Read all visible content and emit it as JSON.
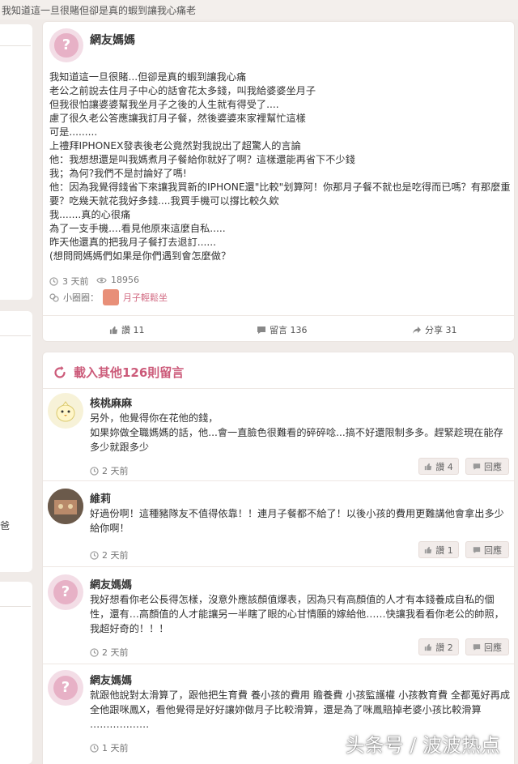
{
  "topbar": {
    "title": "我知道這一旦很賭但卻是真的蝦到讓我心痛老"
  },
  "side": {
    "fragment_char": "爸"
  },
  "post": {
    "author": "網友媽媽",
    "lines": [
      "我知道這一旦很賭...但卻是真的蝦到讓我心痛",
      "老公之前說去住月子中心的話會花太多錢，叫我給婆婆坐月子",
      "但我很怕讓婆婆幫我坐月子之後的人生就有得受了....",
      "慮了很久老公答應讓我訂月子餐，然後婆婆來家裡幫忙這樣",
      "可是.........",
      "上禮拜IPHONEX發表後老公竟然對我說出了超驚人的言論",
      "他：我想想還是叫我媽煮月子餐給你就好了啊？這樣還能再省下不少錢",
      "我；為何?我們不是討論好了嗎!",
      "他：因為我覺得錢省下來讓我買新的IPHONE還\"比較\"划算阿！你那月子餐不就也是吃得而已嗎？有那麼重要？吃幾天就花我好多錢....我買手機可以撐比較久欸",
      "我.......真的心很痛",
      "為了一支手機....看見他原來這麼自私.....",
      "昨天他還真的把我月子餐打去退訂......",
      "(想問問媽媽們如果是你們遇到會怎麼做？"
    ],
    "time": "3 天前",
    "views": "18956",
    "group_label": "小圈圈：",
    "group_name": "月子輕鬆坐",
    "like_label": "讚 11",
    "comment_label": "留言 136",
    "share_label": "分享 31"
  },
  "comments_section": {
    "load_more": "載入其他126則留言",
    "reply_label": "回應",
    "comments": [
      {
        "author": "核桃麻麻",
        "lines": [
          "另外，他覺得你在花他的錢，",
          "如果妳做全職媽媽的話，他...會一直臉色很難看的碎碎唸...搞不好還限制多多。趕緊趁現在能存多少就跟多少"
        ],
        "time": "2 天前",
        "likes": "讚 4"
      },
      {
        "author": "維莉",
        "lines": [
          "好過份啊！這種豬隊友不值得依靠！！連月子餐都不給了！以後小孩的費用更難講他會拿出多少給你啊！"
        ],
        "time": "2 天前",
        "likes": "讚 1"
      },
      {
        "author": "網友媽媽",
        "lines": [
          "我好想看你老公長得怎樣，沒意外應該顏值爆表，因為只有高顏值的人才有本錢養成自私的個性，還有…高顏值的人才能讓另一半瞎了眼的心甘情願的嫁給他……快讓我看看你老公的帥照，我超好奇的！！！"
        ],
        "time": "2 天前",
        "likes": "讚 2"
      },
      {
        "author": "網友媽媽",
        "lines": [
          "就跟他說對太滑算了，跟他把生育費 養小孩的費用 贍養費 小孩監護權 小孩教育費 全都蒐好再成全他跟咪鳳X，看他覺得是好好讓妳做月子比較滑算，還是為了咪鳳賠掉老婆小孩比較滑算",
          "………………"
        ],
        "time": "1 天前",
        "likes": ""
      }
    ]
  },
  "watermark": "头条号 / 波波热点",
  "colors": {
    "accent": "#cc5b7a",
    "background": "#f0ebe8",
    "avatar_pink": "#e7b1c6"
  }
}
